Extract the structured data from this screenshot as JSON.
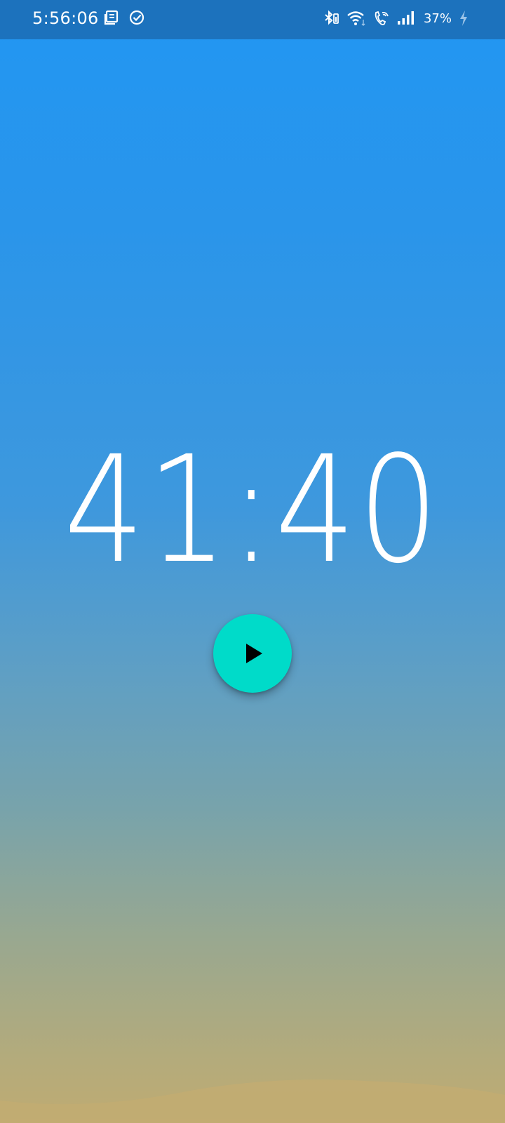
{
  "status_bar": {
    "time": "5:56:06",
    "battery_percent": "37%",
    "left_icons": [
      "notes-icon",
      "check-circle-icon"
    ],
    "right_icons": [
      "bluetooth-icon",
      "wifi-icon",
      "wifi-calling-icon",
      "signal-icon",
      "charging-bolt-icon"
    ]
  },
  "timer": {
    "display": "41:40"
  },
  "controls": {
    "play_icon": "play-icon",
    "accent_color": "#00dbc9"
  },
  "theme": {
    "gradient_top": "#2196f3",
    "gradient_bottom": "#bfab72",
    "sand_color": "#c2ac72"
  }
}
